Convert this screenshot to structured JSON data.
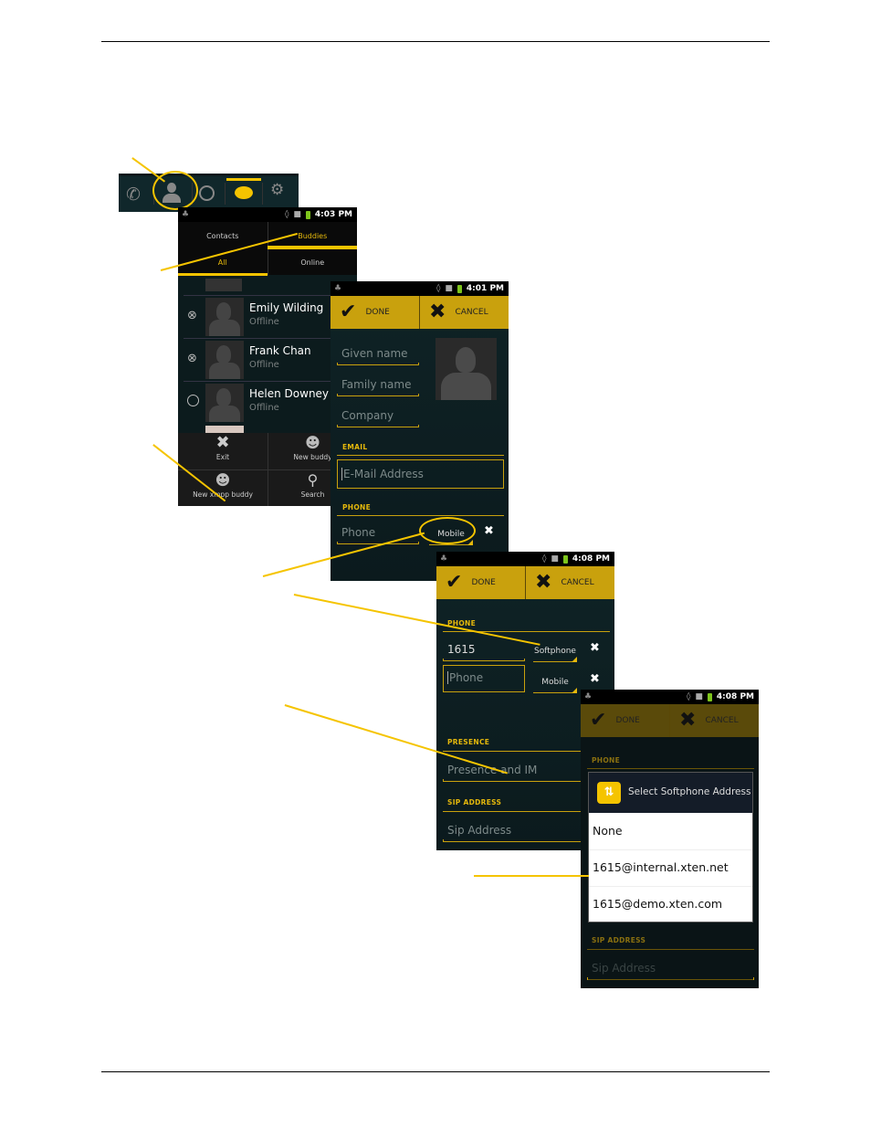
{
  "document": {
    "accent_color": "#f5c400",
    "app_accent": "#c9a10d"
  },
  "tabbar": {
    "icons": [
      "phone-icon",
      "contacts-icon",
      "history-icon",
      "chat-icon",
      "settings-icon"
    ],
    "selected": "contacts-icon"
  },
  "screen1": {
    "status": {
      "time": "4:03 PM"
    },
    "tabs": [
      {
        "label": "Contacts",
        "active": false
      },
      {
        "label": "Buddies",
        "active": true
      }
    ],
    "subtabs": [
      {
        "label": "All",
        "active": true
      },
      {
        "label": "Online",
        "active": false
      }
    ],
    "contacts": [
      {
        "name": "Emily Wilding",
        "status": "Offline",
        "indicator": "blocked"
      },
      {
        "name": "Frank Chan",
        "status": "Offline",
        "indicator": "blocked"
      },
      {
        "name": "Helen Downey",
        "status": "Offline",
        "indicator": "empty"
      }
    ],
    "menu": [
      {
        "label": "Exit",
        "icon": "close-icon"
      },
      {
        "label": "New buddy",
        "icon": "add-buddy-icon"
      },
      {
        "label": "New xmpp buddy",
        "icon": "add-xmpp-buddy-icon"
      },
      {
        "label": "Search",
        "icon": "search-icon"
      }
    ]
  },
  "screen2": {
    "status": {
      "time": "4:01 PM"
    },
    "done_label": "DONE",
    "cancel_label": "CANCEL",
    "given_name_placeholder": "Given name",
    "family_name_placeholder": "Family name",
    "company_placeholder": "Company",
    "email_section": "EMAIL",
    "email_placeholder": "E-Mail Address",
    "phone_section": "PHONE",
    "phone_placeholder": "Phone",
    "phone_type": "Mobile"
  },
  "screen3": {
    "status": {
      "time": "4:08 PM"
    },
    "done_label": "DONE",
    "cancel_label": "CANCEL",
    "phone_section": "PHONE",
    "phones": [
      {
        "value": "1615",
        "type": "Softphone"
      },
      {
        "value": "",
        "placeholder": "Phone",
        "type": "Mobile"
      }
    ],
    "presence_section": "PRESENCE",
    "presence_placeholder": "Presence and IM",
    "sip_section": "SIP ADDRESS",
    "sip_placeholder": "Sip Address"
  },
  "screen4": {
    "status": {
      "time": "4:08 PM"
    },
    "done_label": "DONE",
    "cancel_label": "CANCEL",
    "phone_section": "PHONE",
    "dialog": {
      "title": "Select Softphone Address",
      "options": [
        "None",
        "1615@internal.xten.net",
        "1615@demo.xten.com"
      ]
    },
    "sip_section": "SIP ADDRESS",
    "sip_placeholder": "Sip Address"
  }
}
